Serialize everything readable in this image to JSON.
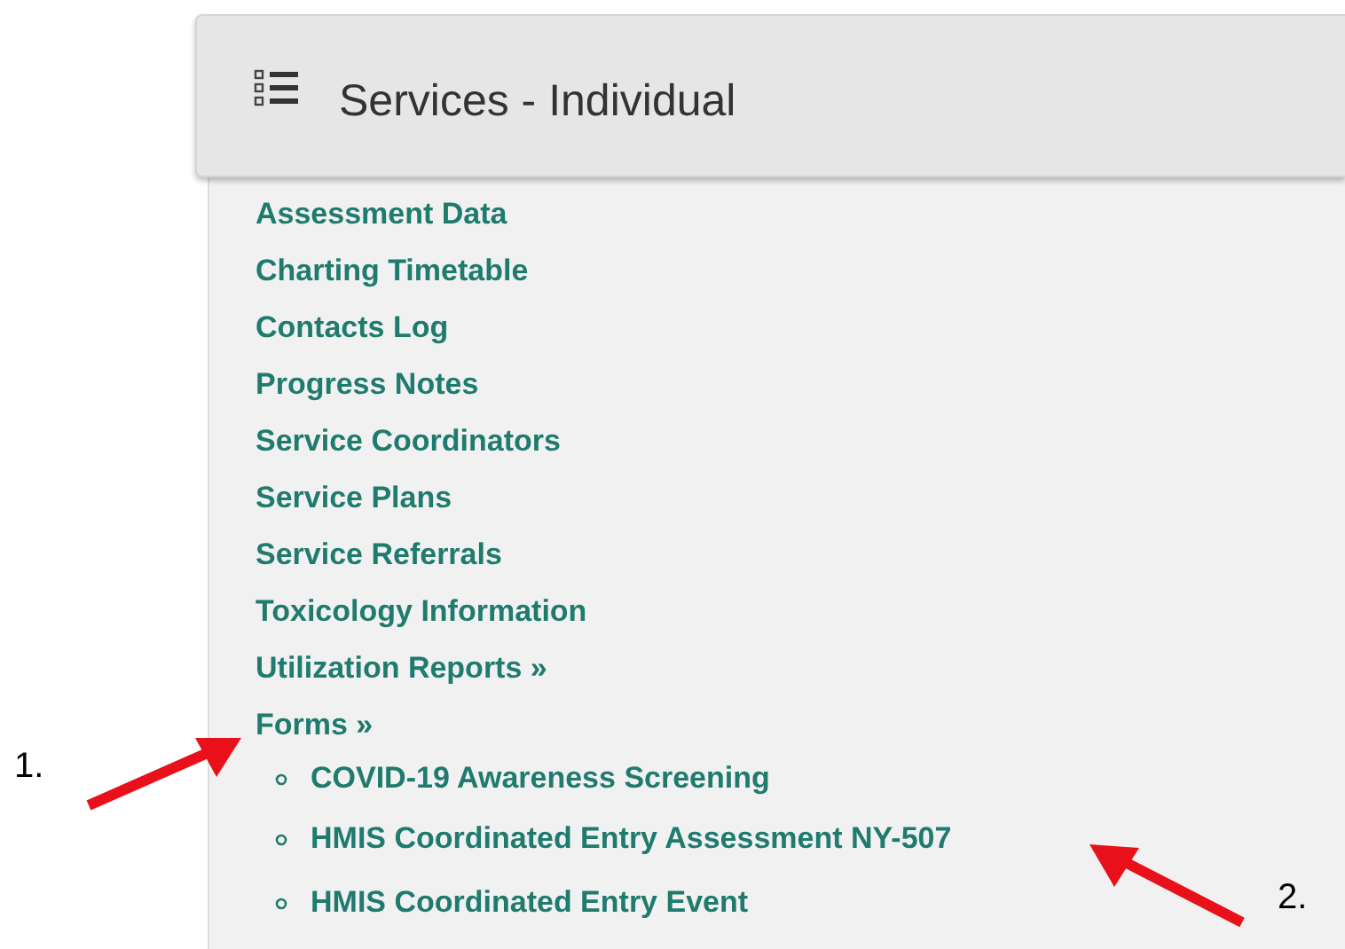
{
  "panel": {
    "title": "Services - Individual"
  },
  "menu": [
    {
      "label": "Assessment Data"
    },
    {
      "label": "Charting Timetable"
    },
    {
      "label": "Contacts Log"
    },
    {
      "label": "Progress Notes"
    },
    {
      "label": "Service Coordinators"
    },
    {
      "label": "Service Plans"
    },
    {
      "label": "Service Referrals"
    },
    {
      "label": "Toxicology Information"
    },
    {
      "label": "Utilization Reports »"
    },
    {
      "label": "Forms »",
      "children": [
        {
          "label": "COVID-19 Awareness Screening"
        },
        {
          "label": "HMIS Coordinated Entry Assessment NY-507"
        },
        {
          "label": "HMIS Coordinated Entry Event"
        }
      ]
    }
  ],
  "annotations": [
    {
      "label": "1."
    },
    {
      "label": "2."
    }
  ]
}
